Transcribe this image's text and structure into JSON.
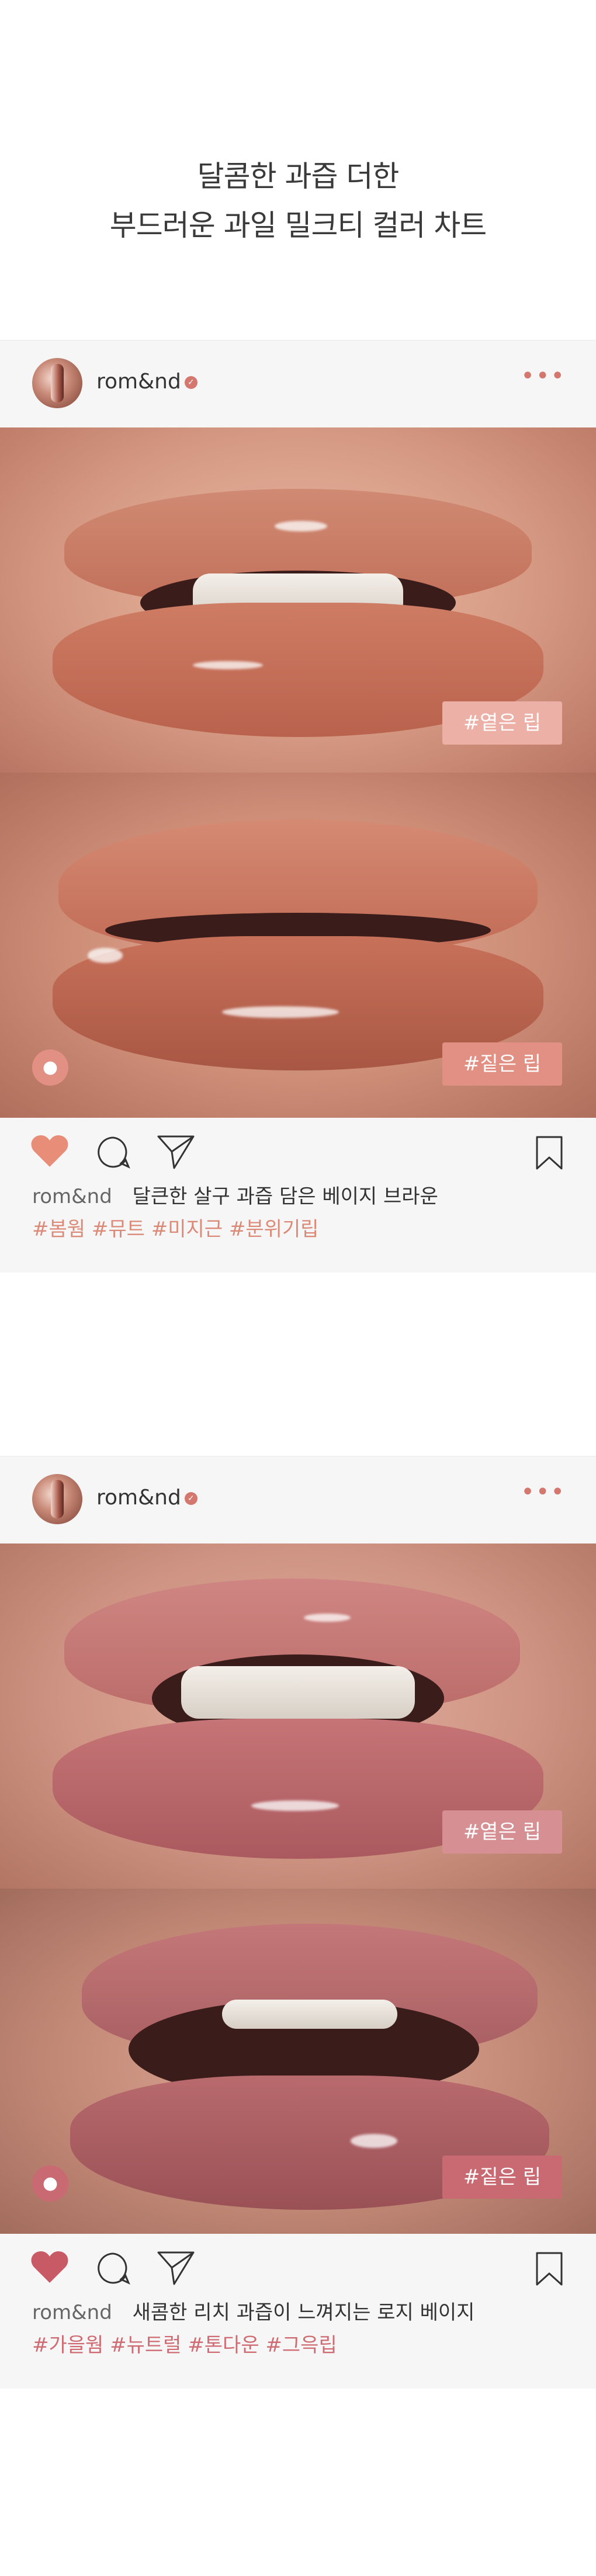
{
  "headline": {
    "line1": "달콤한 과즙 더한",
    "line2": "부드러운 과일 밀크티 컬러 차트"
  },
  "posts": [
    {
      "account": "rom&nd",
      "verified_icon": "check-icon",
      "more_icon": "ellipsis-icon",
      "photo_top_badge": "#옅은 립",
      "photo_bottom_badge": "#짙은 립",
      "badge_color_top": "#ecb0a6",
      "badge_color_bottom": "#e39084",
      "caption_user": "rom&nd",
      "caption_text": "달큰한 살구 과즙 담은 베이지 브라운",
      "hashtags": "#봄웜 #뮤트 #미지근 #분위기립",
      "heart_color": "#e88d78",
      "hashtag_color": "#dc8a78"
    },
    {
      "account": "rom&nd",
      "verified_icon": "check-icon",
      "more_icon": "ellipsis-icon",
      "photo_top_badge": "#옅은 립",
      "photo_bottom_badge": "#짙은 립",
      "badge_color_top": "#d68f92",
      "badge_color_bottom": "#c96a73",
      "caption_user": "rom&nd",
      "caption_text": "새콤한 리치 과즙이 느껴지는 로지 베이지",
      "hashtags": "#가을웜 #뉴트럴 #톤다운 #그윽립",
      "heart_color": "#c85a66",
      "hashtag_color": "#cf6b73"
    }
  ]
}
